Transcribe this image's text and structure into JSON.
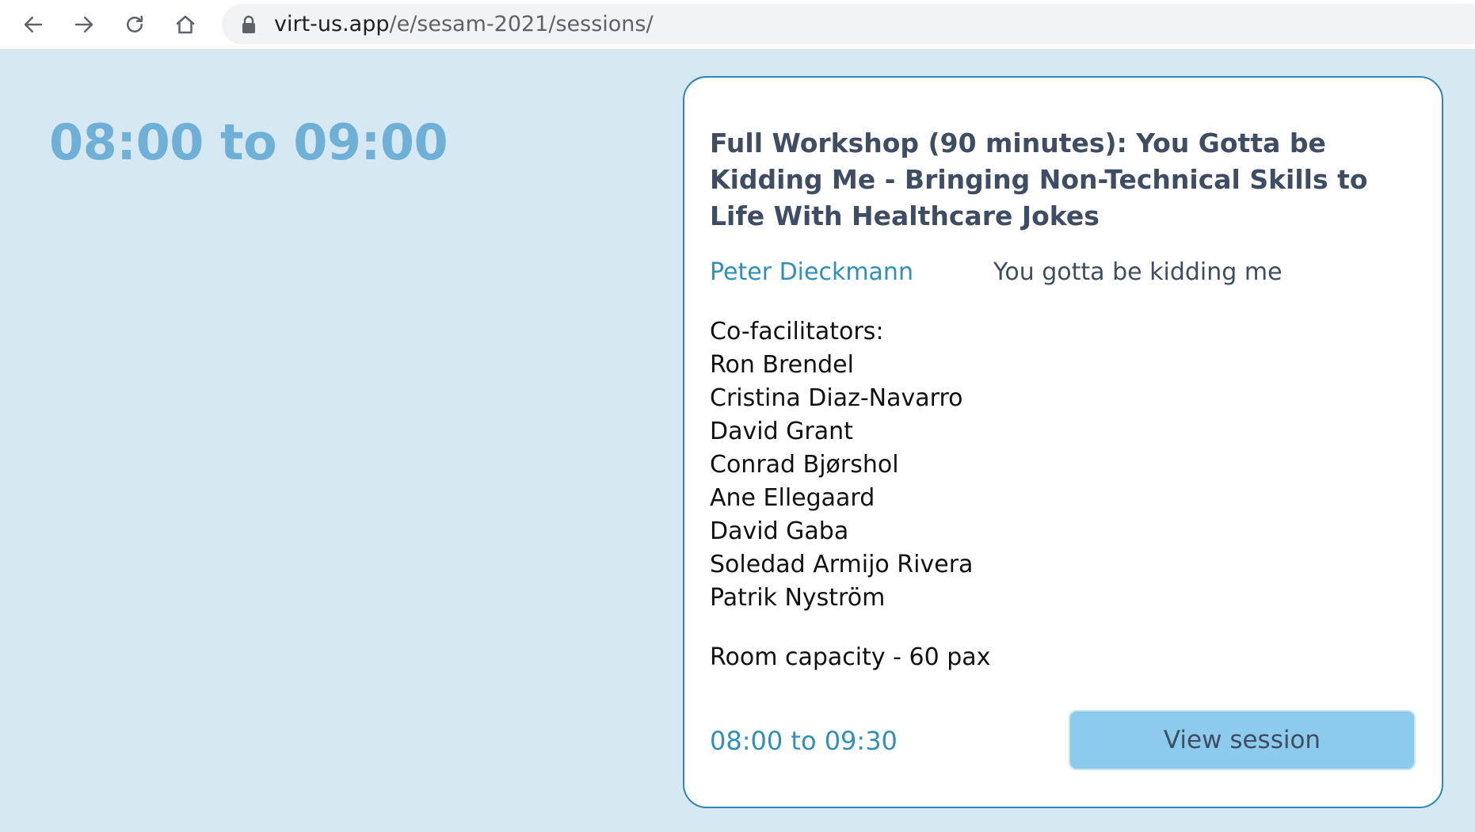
{
  "browser": {
    "url_host": "virt-us.app",
    "url_path": "/e/sesam-2021/sessions/",
    "icons": [
      "back-arrow-icon",
      "forward-arrow-icon",
      "reload-icon",
      "home-icon",
      "lock-icon"
    ]
  },
  "timeslot": {
    "heading": "08:00 to 09:00"
  },
  "session": {
    "title": "Full Workshop (90 minutes): You Gotta be Kidding Me - Bringing Non-Technical Skills to Life With Healthcare Jokes",
    "speaker": "Peter Dieckmann",
    "subtitle": "You gotta be kidding me",
    "cofacilitators_label": "Co-facilitators:",
    "cofacilitators": [
      "Ron Brendel",
      "Cristina Diaz-Navarro",
      "David Grant",
      "Conrad Bjørshol",
      "Ane Ellegaard",
      "David Gaba",
      "Soledad Armijo Rivera",
      "Patrik Nyström"
    ],
    "capacity": "Room capacity - 60 pax",
    "time": "08:00 to 09:30",
    "view_button": "View session"
  },
  "colors": {
    "background": "#d6e8f1",
    "accent": "#2f90bd",
    "heading": "#6fb0d6",
    "button": "#8ccbeb",
    "title": "#3e4d63"
  }
}
